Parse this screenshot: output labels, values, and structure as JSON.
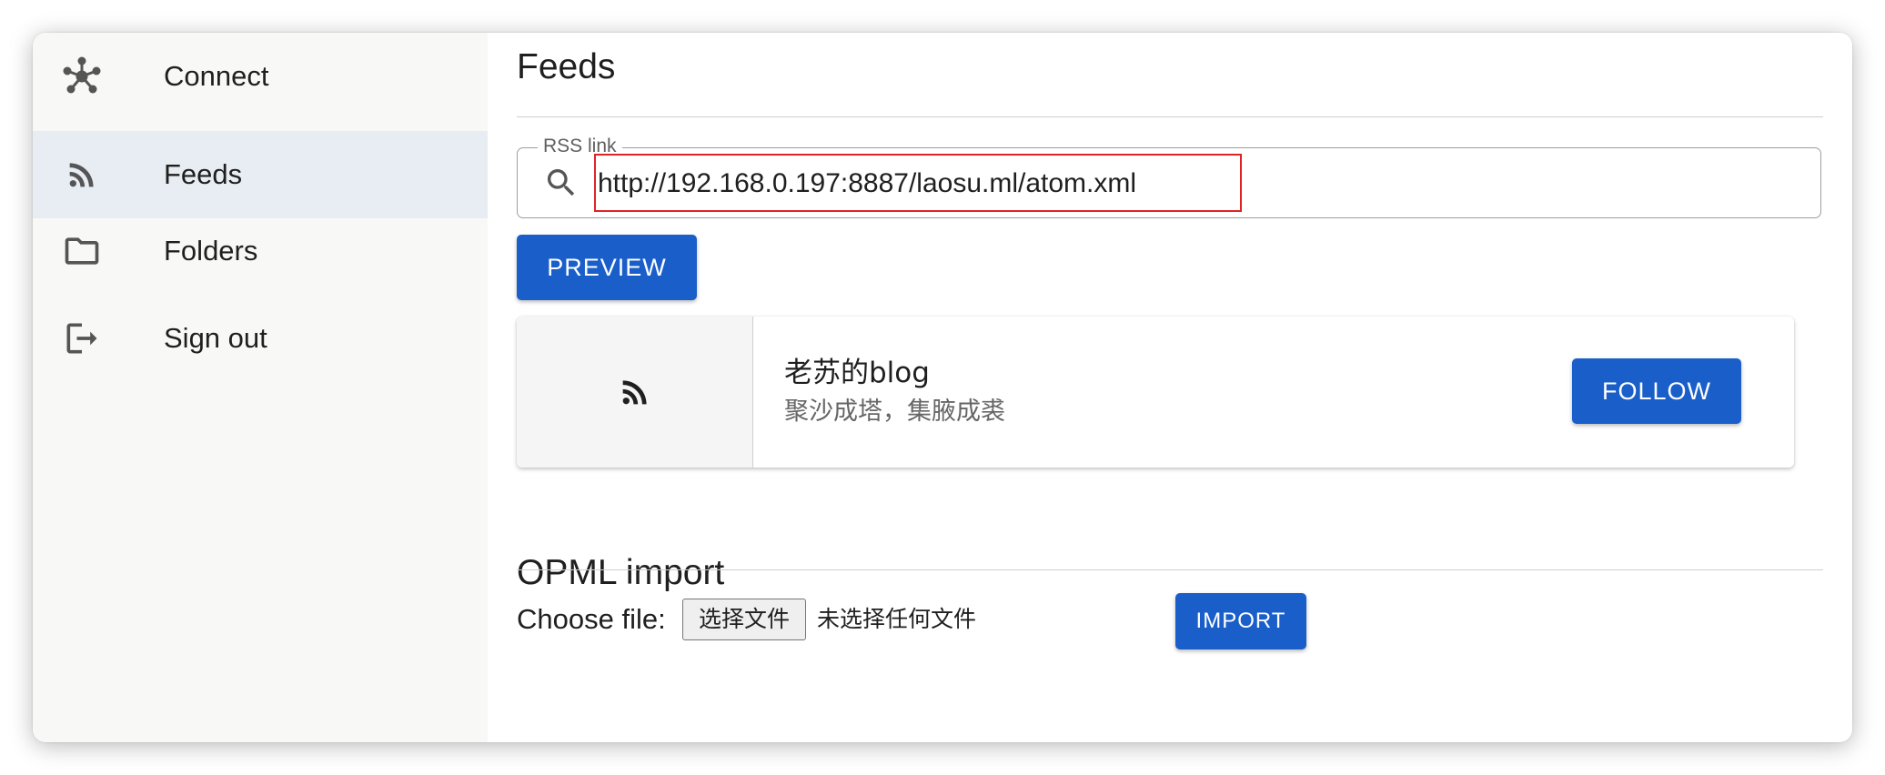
{
  "sidebar": {
    "items": [
      {
        "label": "Connect",
        "icon": "hub-icon",
        "active": false
      },
      {
        "label": "Feeds",
        "icon": "rss-icon",
        "active": true
      },
      {
        "label": "Folders",
        "icon": "folder-icon",
        "active": false
      },
      {
        "label": "Sign out",
        "icon": "logout-icon",
        "active": false
      }
    ]
  },
  "feeds": {
    "title": "Feeds",
    "rss_field": {
      "label": "RSS link",
      "value": "http://192.168.0.197:8887/laosu.ml/atom.xml",
      "icon": "search-icon"
    },
    "preview_label": "PREVIEW",
    "preview_card": {
      "icon": "rss-icon",
      "title": "老苏的blog",
      "description": "聚沙成塔，集腋成裘",
      "follow_label": "FOLLOW"
    }
  },
  "opml": {
    "title": "OPML import",
    "choose_label": "Choose file:",
    "file_button_label": "选择文件",
    "no_file_text": "未选择任何文件",
    "import_label": "IMPORT"
  },
  "colors": {
    "primary": "#1a5fc9",
    "sidebar_bg": "#f8f8f7",
    "active_item_bg": "#e8edf4",
    "highlight_border": "#e02424"
  }
}
